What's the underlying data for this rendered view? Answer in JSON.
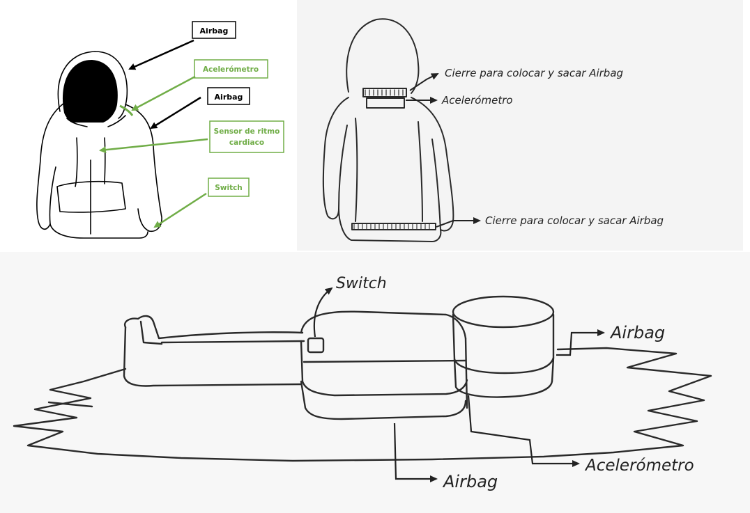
{
  "panel_digital": {
    "labels": {
      "airbag_top": "Airbag",
      "accelerometer": "Acelerómetro",
      "airbag_shoulder": "Airbag",
      "heart_sensor_line1": "Sensor de ritmo",
      "heart_sensor_line2": "cardiaco",
      "switch": "Switch"
    },
    "colors": {
      "accent": "#70ad47",
      "ink": "#000000"
    }
  },
  "panel_sketch_back": {
    "labels": {
      "zipper_top": "Cierre para colocar y sacar Airbag",
      "accelerometer": "Acelerómetro",
      "zipper_bottom": "Cierre para colocar y sacar Airbag"
    }
  },
  "panel_sketch_folded": {
    "labels": {
      "switch": "Switch",
      "airbag_right": "Airbag",
      "accelerometer": "Acelerómetro",
      "airbag_bottom": "Airbag"
    }
  }
}
